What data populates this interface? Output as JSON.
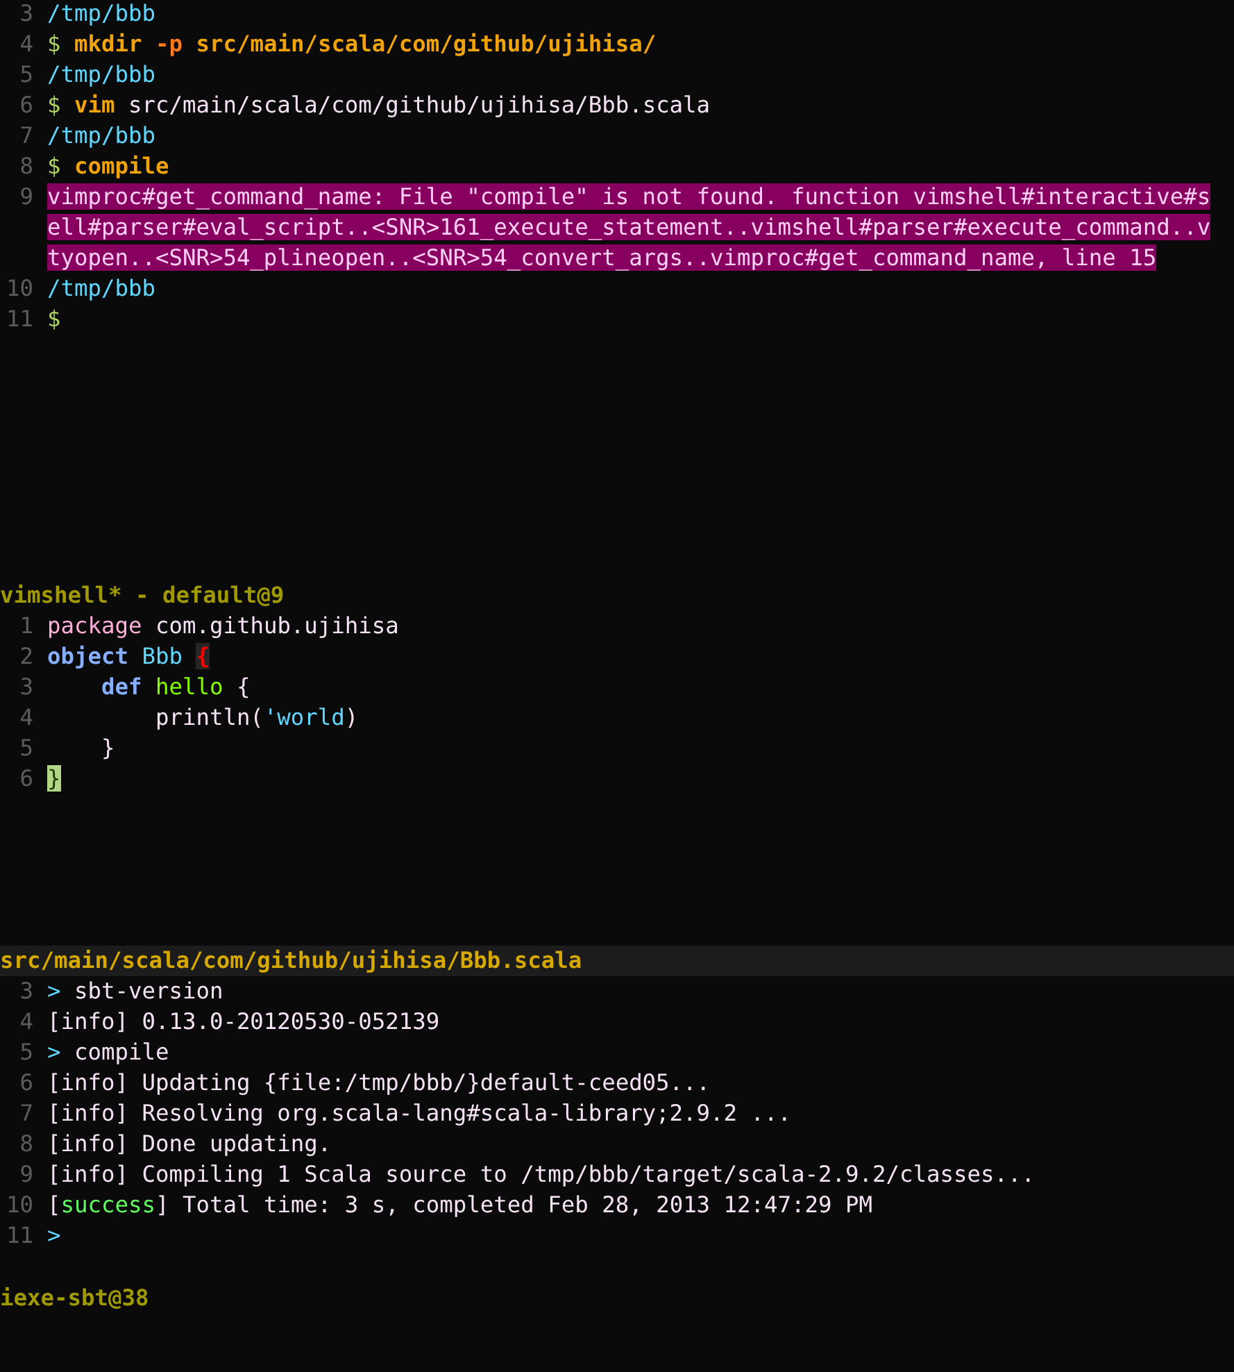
{
  "panes": [
    {
      "lines": [
        {
          "number": "3",
          "segments": [
            {
              "text": "/tmp/bbb",
              "kind": "path"
            }
          ]
        },
        {
          "number": "4",
          "segments": [
            {
              "text": "$ ",
              "kind": "prompt"
            },
            {
              "text": "mkdir ",
              "kind": "command"
            },
            {
              "text": "-p ",
              "kind": "option"
            },
            {
              "text": "src/main/scala/com/github/ujihisa/",
              "kind": "command"
            }
          ]
        },
        {
          "number": "5",
          "segments": [
            {
              "text": "/tmp/bbb",
              "kind": "path"
            }
          ]
        },
        {
          "number": "6",
          "segments": [
            {
              "text": "$ ",
              "kind": "prompt"
            },
            {
              "text": "vim ",
              "kind": "command"
            },
            {
              "text": "src/main/scala/com/github/ujihisa/Bbb.scala",
              "kind": "plain"
            }
          ]
        },
        {
          "number": "7",
          "segments": [
            {
              "text": "/tmp/bbb",
              "kind": "path"
            }
          ]
        },
        {
          "number": "8",
          "segments": [
            {
              "text": "$ ",
              "kind": "prompt"
            },
            {
              "text": "compile",
              "kind": "command"
            }
          ]
        },
        {
          "number": "9",
          "segments": [
            {
              "text": "vimproc#get_command_name: File \"compile\" is not found. function vimshell#interactive#s",
              "kind": "error"
            }
          ]
        },
        {
          "segments": [
            {
              "text": "ell#parser#eval_script..<SNR>161_execute_statement..vimshell#parser#execute_command..v",
              "kind": "error"
            }
          ]
        },
        {
          "segments": [
            {
              "text": "tyopen..<SNR>54_plineopen..<SNR>54_convert_args..vimproc#get_command_name, line 15",
              "kind": "error"
            }
          ]
        },
        {
          "number": "10",
          "segments": [
            {
              "text": "/tmp/bbb",
              "kind": "path"
            }
          ]
        },
        {
          "number": "11",
          "segments": [
            {
              "text": "$",
              "kind": "prompt"
            }
          ]
        }
      ],
      "status": {
        "text": "vimshell* - default@9",
        "active": false
      }
    },
    {
      "lines": [
        {
          "number": "1",
          "segments": [
            {
              "text": "package",
              "kind": "keyword"
            },
            {
              "text": " com.github.ujihisa",
              "kind": "plain"
            }
          ]
        },
        {
          "number": "2",
          "segments": [
            {
              "text": "object ",
              "kind": "type-keyword"
            },
            {
              "text": "Bbb ",
              "kind": "type"
            },
            {
              "text": "{",
              "kind": "match"
            }
          ]
        },
        {
          "number": "3",
          "segments": [
            {
              "text": "    def ",
              "kind": "type-keyword"
            },
            {
              "text": "hello",
              "kind": "function"
            },
            {
              "text": " {",
              "kind": "plain"
            }
          ]
        },
        {
          "number": "4",
          "segments": [
            {
              "text": "        println(",
              "kind": "plain"
            },
            {
              "text": "'world",
              "kind": "symbol"
            },
            {
              "text": ")",
              "kind": "plain"
            }
          ]
        },
        {
          "number": "5",
          "segments": [
            {
              "text": "    }",
              "kind": "plain"
            }
          ]
        },
        {
          "number": "6",
          "segments": [
            {
              "text": "}",
              "kind": "cursor"
            }
          ]
        }
      ],
      "status": {
        "text": "src/main/scala/com/github/ujihisa/Bbb.scala",
        "active": true
      }
    },
    {
      "lines": [
        {
          "number": "3",
          "segments": [
            {
              "text": "> ",
              "kind": "path"
            },
            {
              "text": "sbt-version",
              "kind": "plain"
            }
          ]
        },
        {
          "number": "4",
          "segments": [
            {
              "text": "[info] 0.13.0-20120530-052139",
              "kind": "plain"
            }
          ]
        },
        {
          "number": "5",
          "segments": [
            {
              "text": "> ",
              "kind": "path"
            },
            {
              "text": "compile",
              "kind": "plain"
            }
          ]
        },
        {
          "number": "6",
          "segments": [
            {
              "text": "[info] Updating {file:/tmp/bbb/}default-ceed05...",
              "kind": "plain"
            }
          ]
        },
        {
          "number": "7",
          "segments": [
            {
              "text": "[info] Resolving org.scala-lang#scala-library;2.9.2 ...",
              "kind": "plain"
            }
          ]
        },
        {
          "number": "8",
          "segments": [
            {
              "text": "[info] Done updating.",
              "kind": "plain"
            }
          ]
        },
        {
          "number": "9",
          "segments": [
            {
              "text": "[info] Compiling 1 Scala source to /tmp/bbb/target/scala-2.9.2/classes...",
              "kind": "plain"
            }
          ]
        },
        {
          "number": "10",
          "segments": [
            {
              "text": "[",
              "kind": "plain"
            },
            {
              "text": "success",
              "kind": "success"
            },
            {
              "text": "] Total time: 3 s, completed Feb 28, 2013 12:47:29 PM",
              "kind": "plain"
            }
          ]
        },
        {
          "number": "11",
          "segments": [
            {
              "text": ">",
              "kind": "path"
            }
          ]
        }
      ],
      "status": {
        "text": "iexe-sbt@38",
        "active": false
      }
    }
  ]
}
